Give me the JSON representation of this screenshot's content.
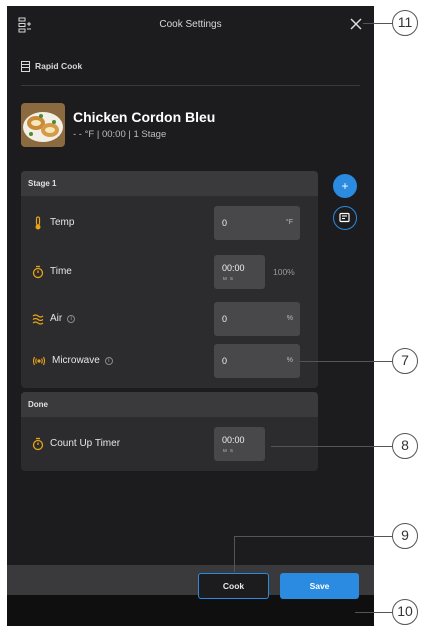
{
  "header": {
    "title": "Cook Settings",
    "menu_icon": "stack-add-icon",
    "close_icon": "close-icon"
  },
  "mode": {
    "label": "Rapid Cook",
    "icon": "oven-icon"
  },
  "recipe": {
    "name": "Chicken Cordon Bleu",
    "meta": "- - °F | 00:00 | 1 Stage"
  },
  "stage1": {
    "title": "Stage 1",
    "temp": {
      "label": "Temp",
      "value": "0",
      "unit": "°F",
      "icon": "thermometer-icon"
    },
    "time": {
      "label": "Time",
      "value": "00:00",
      "sub": "M   S",
      "percent": "100%",
      "icon": "timer-icon"
    },
    "air": {
      "label": "Air",
      "value": "0",
      "unit": "%",
      "icon": "air-waves-icon",
      "info": "i"
    },
    "microwave": {
      "label": "Microwave",
      "value": "0",
      "unit": "%",
      "icon": "microwave-signal-icon",
      "info": "i"
    }
  },
  "done": {
    "title": "Done",
    "timer": {
      "label": "Count Up Timer",
      "value": "00:00",
      "sub": "M   S",
      "icon": "timer-icon"
    }
  },
  "fab": {
    "add": "+",
    "note_icon": "note-edit-icon"
  },
  "actions": {
    "cook": "Cook",
    "save": "Save"
  },
  "callouts": {
    "c11": "11",
    "c7": "7",
    "c8": "8",
    "c9": "9",
    "c10": "10"
  },
  "colors": {
    "accent": "#2a8be0",
    "warning": "#e8a317",
    "background": "#1c1c1e"
  }
}
